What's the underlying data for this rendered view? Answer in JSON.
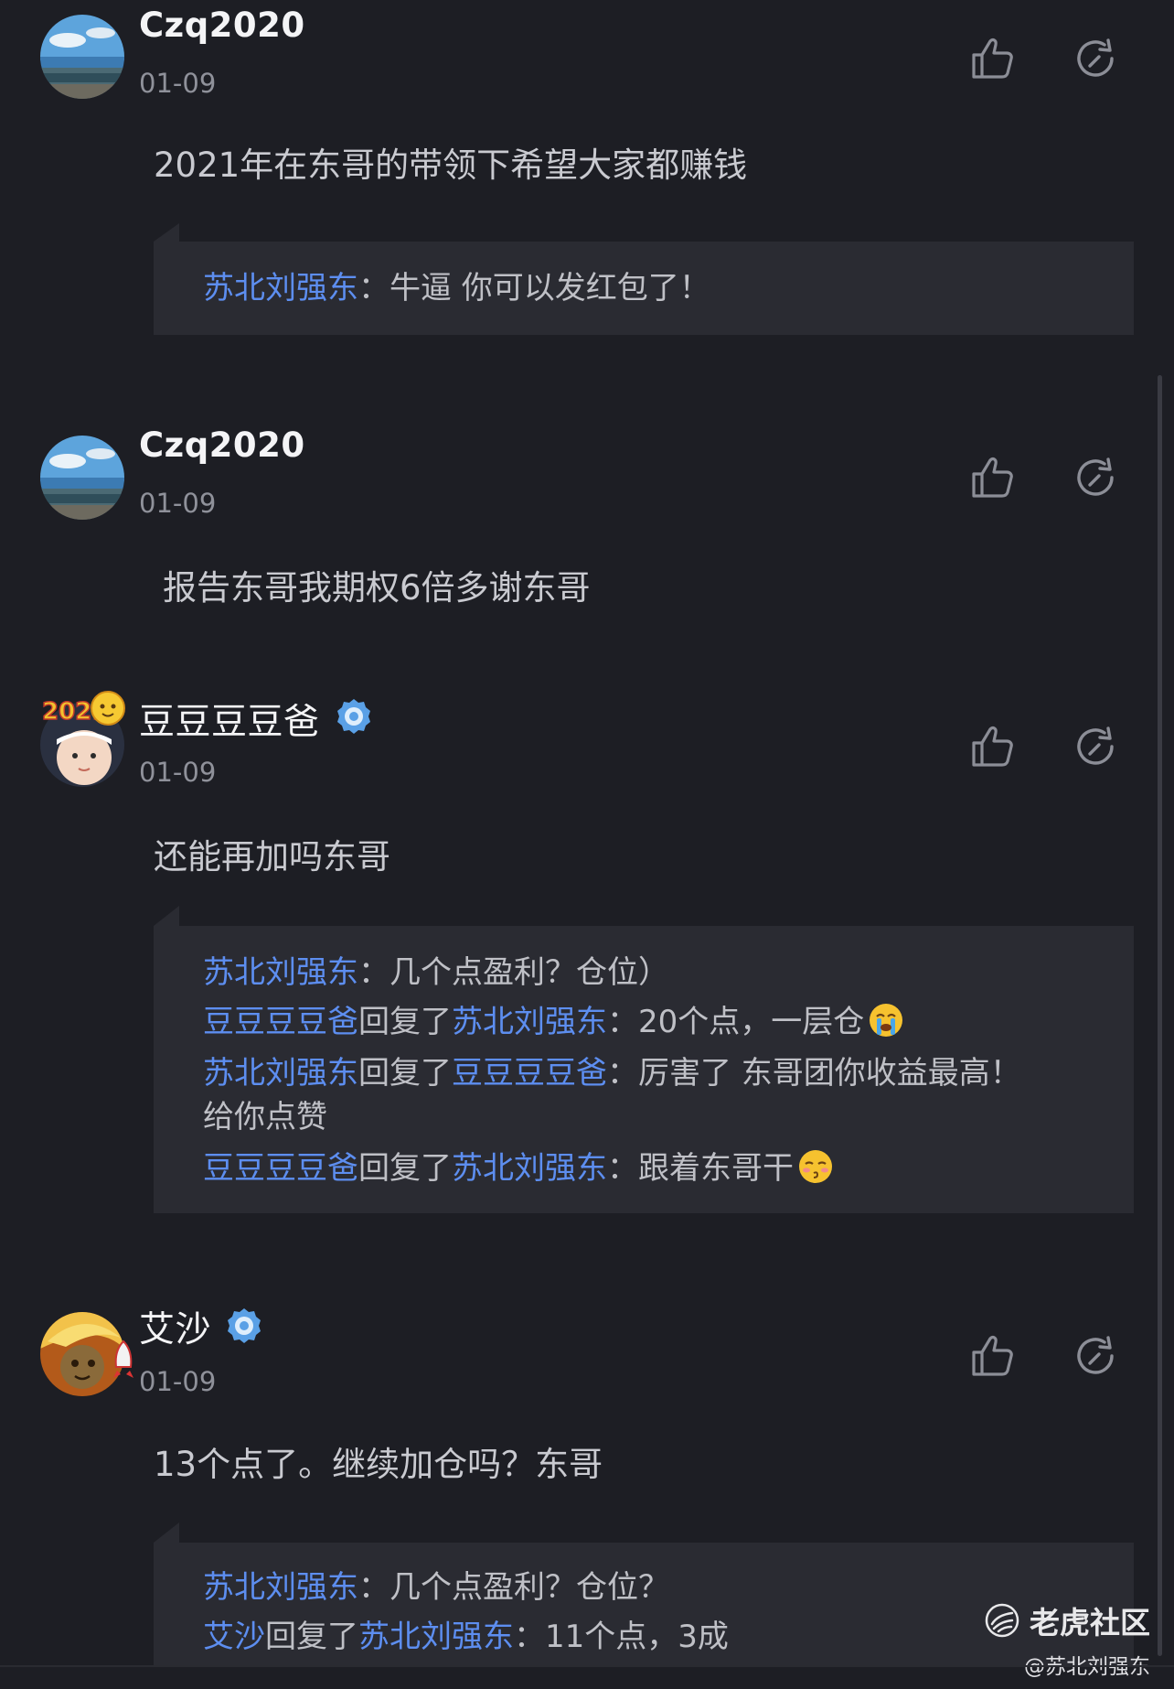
{
  "comments": [
    {
      "username": "Czq2020",
      "date": "01-09",
      "text": "2021年在东哥的带领下希望大家都赚钱",
      "verified": false,
      "avatar": "sea-landscape-avatar",
      "replies": [
        {
          "from": "苏北刘强东",
          "to": "",
          "joiner": "",
          "sep": "：",
          "text": "牛逼 你可以发红包了！"
        }
      ]
    },
    {
      "username": "Czq2020",
      "date": "01-09",
      "text": "报告东哥我期权6倍多谢东哥",
      "verified": false,
      "avatar": "sea-landscape-avatar",
      "replies": []
    },
    {
      "username": "豆豆豆豆爸",
      "date": "01-09",
      "text": "还能再加吗东哥",
      "verified": true,
      "avatar": "baby-2021-avatar",
      "replies": [
        {
          "from": "苏北刘强东",
          "to": "",
          "joiner": "",
          "sep": "：",
          "text": "几个点盈利？仓位）"
        },
        {
          "from": "豆豆豆豆爸",
          "joiner": "回复了",
          "to": "苏北刘强东",
          "sep": "：",
          "text": "20个点，一层仓",
          "emoji": "crying-emoji"
        },
        {
          "from": "苏北刘强东",
          "joiner": "回复了",
          "to": "豆豆豆豆爸",
          "sep": "：",
          "text": "厉害了 东哥团你收益最高！",
          "text2": "给你点赞"
        },
        {
          "from": "豆豆豆豆爸",
          "joiner": "回复了",
          "to": "苏北刘强东",
          "sep": "：",
          "text": "跟着东哥干",
          "emoji": "kissing-emoji"
        }
      ]
    },
    {
      "username": "艾沙",
      "date": "01-09",
      "text": "13个点了。继续加仓吗？东哥",
      "verified": true,
      "avatar": "golden-hair-cartoon-avatar",
      "replies": [
        {
          "from": "苏北刘强东",
          "to": "",
          "joiner": "",
          "sep": "：",
          "text": "几个点盈利？仓位？"
        },
        {
          "from": "艾沙",
          "joiner": "回复了",
          "to": "苏北刘强东",
          "sep": "：",
          "text": "11个点，3成"
        }
      ]
    }
  ],
  "icons": {
    "like": "thumbs-up-icon",
    "share": "share-icon",
    "verified": "verified-badge-icon"
  },
  "watermark": {
    "brand": "老虎社区",
    "user": "@苏北刘强东"
  },
  "colors": {
    "background": "#1d1e24",
    "reply_background": "#2a2b32",
    "link_blue": "#5d8ef0",
    "username": "#f4f4f6",
    "date": "#8f919a",
    "badge_blue": "#5aa0e6"
  }
}
